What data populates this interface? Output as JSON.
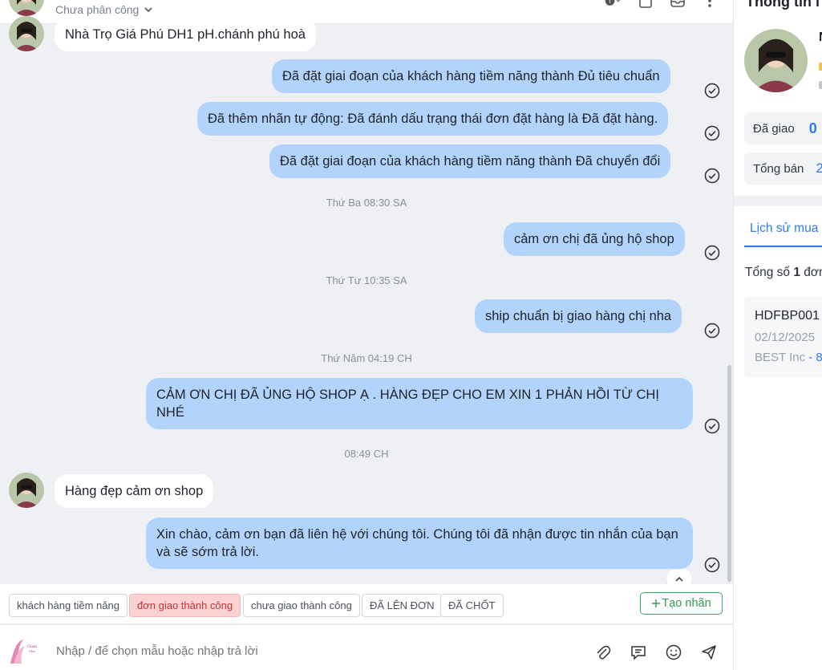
{
  "header": {
    "assign_label": "Chưa phân công"
  },
  "messages": [
    {
      "dir": "in",
      "text": "Nhà Trọ Giá Phú DH1 pH.chánh phú hoà"
    },
    {
      "dir": "out",
      "text": "Đã đặt giai đoạn của khách hàng tiềm năng thành Đủ tiêu chuẩn"
    },
    {
      "dir": "out",
      "text": "Đã thêm nhãn tự động: Đã đánh dấu trạng thái đơn đặt hàng là Đã đặt hàng."
    },
    {
      "dir": "out",
      "text": "Đã đặt giai đoạn của khách hàng tiềm năng thành Đã chuyển đổi"
    },
    {
      "dir": "sep",
      "text": "Thứ Ba 08:30 SA"
    },
    {
      "dir": "out",
      "text": "cảm ơn chị đã ủng hộ shop"
    },
    {
      "dir": "sep",
      "text": "Thứ Tư 10:35 SA"
    },
    {
      "dir": "out",
      "text": "ship chuẩn bị giao hàng chị nha"
    },
    {
      "dir": "sep",
      "text": "Thứ Năm 04:19 CH"
    },
    {
      "dir": "out",
      "text": "CẢM ƠN CHỊ ĐÃ ỦNG HỘ SHOP Ạ . HÀNG ĐẸP CHO EM XIN 1 PHẢN HỒI TỪ CHỊ NHÉ"
    },
    {
      "dir": "sep",
      "text": "08:49 CH"
    },
    {
      "dir": "in",
      "text": "Hàng đẹp cảm ơn shop"
    },
    {
      "dir": "out",
      "text": "Xin chào, cảm ơn bạn đã liên hệ với chúng tôi. Chúng tôi đã nhận được tin nhắn của bạn và sẽ sớm trả lời."
    }
  ],
  "tags": [
    {
      "label": "khách hàng tiềm năng",
      "active": false
    },
    {
      "label": "đơn giao thành công",
      "active": true
    },
    {
      "label": "chưa giao thành công",
      "active": false
    },
    {
      "label": "ĐÃ LÊN ĐƠN",
      "active": false
    },
    {
      "label": "ĐÃ CHỐT",
      "active": false
    }
  ],
  "create_tag_label": "Tạo nhãn",
  "composer": {
    "placeholder": "Nhập / để chọn mẫu hoặc nhập trả lời"
  },
  "info": {
    "title": "Thông tin l",
    "name_initial": "N",
    "delivered_label": "Đã giao",
    "delivered_value": "0",
    "total_sales_label": "Tổng bán",
    "total_sales_value": "2",
    "tab_label": "Lịch sử mua",
    "total_orders_prefix": "Tổng số",
    "total_orders_count": "1",
    "total_orders_suffix": "đơn",
    "order": {
      "code": "HDFBP001",
      "date": "02/12/2025",
      "carrier": "BEST Inc",
      "carrier_suffix": "- 8"
    }
  },
  "colors": {
    "bubble_out": "#b2d3fb",
    "accent_blue": "#2f7be8",
    "active_tag_bg": "#fbd2d2",
    "create_tag_green": "#2f9a52"
  }
}
